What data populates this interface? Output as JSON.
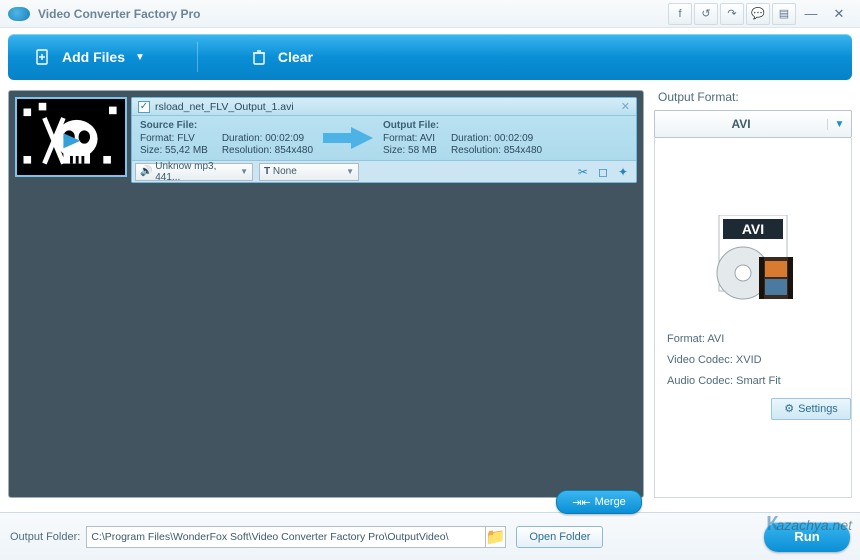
{
  "app": {
    "title": "Video Converter Factory Pro"
  },
  "titlebar_icons": {
    "fb": "f",
    "undo": "↺",
    "redo": "↷",
    "msg": "💬",
    "menu": "▤",
    "min": "—",
    "close": "✕"
  },
  "toolbar": {
    "add_files": "Add Files",
    "clear": "Clear"
  },
  "item": {
    "filename": "rsload_net_FLV_Output_1.avi",
    "source": {
      "header": "Source File:",
      "format_label": "Format:",
      "format": "FLV",
      "duration_label": "Duration:",
      "duration": "00:02:09",
      "size_label": "Size:",
      "size": "55,42 MB",
      "res_label": "Resolution:",
      "res": "854x480"
    },
    "output": {
      "header": "Output File:",
      "format_label": "Format:",
      "format": "AVI",
      "duration_label": "Duration:",
      "duration": "00:02:09",
      "size_label": "Size:",
      "size": "58 MB",
      "res_label": "Resolution:",
      "res": "854x480"
    },
    "audio_dd": "Unknow mp3, 441...",
    "subtitle_prefix": "T",
    "subtitle_dd": "None"
  },
  "right": {
    "title": "Output Format:",
    "selected": "AVI",
    "badge": "AVI",
    "meta_format_label": "Format:",
    "meta_format": "AVI",
    "meta_vcodec_label": "Video Codec:",
    "meta_vcodec": "XVID",
    "meta_acodec_label": "Audio Codec:",
    "meta_acodec": "Smart Fit",
    "settings": "Settings"
  },
  "merge": "Merge",
  "bottom": {
    "label": "Output Folder:",
    "path": "C:\\Program Files\\WonderFox Soft\\Video Converter Factory Pro\\OutputVideo\\",
    "open": "Open Folder",
    "run": "Run"
  },
  "watermark": "azachya.net"
}
